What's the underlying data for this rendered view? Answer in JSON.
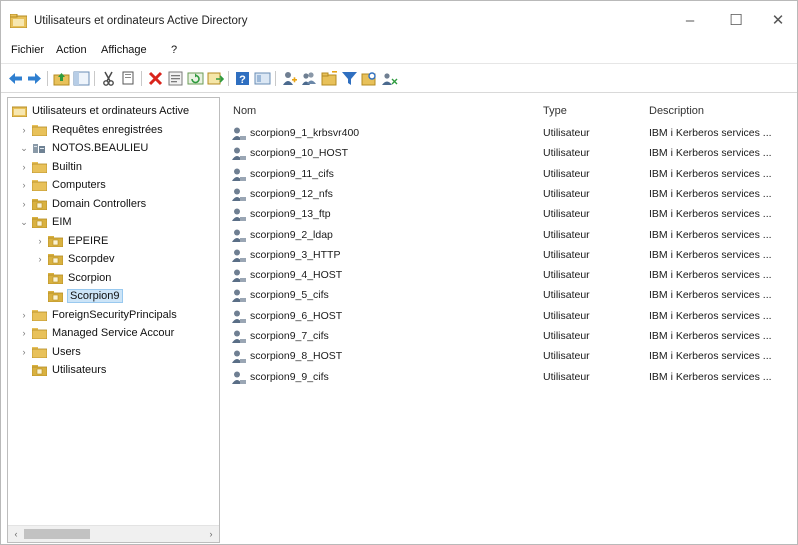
{
  "window": {
    "title": "Utilisateurs et ordinateurs Active Directory",
    "minimize_glyph": "–",
    "maximize_glyph": "☐",
    "close_glyph": "✕"
  },
  "menu": {
    "items": [
      "Fichier",
      "Action",
      "Affichage",
      "?"
    ]
  },
  "toolbar": {
    "icons": [
      "back-arrow-icon",
      "forward-arrow-icon",
      "folder-up-icon",
      "console-tree-icon",
      "cut-icon",
      "copy-icon",
      "delete-icon",
      "properties-icon",
      "refresh-icon",
      "export-list-icon",
      "help-icon",
      "mmc-icon",
      "add-user-icon",
      "add-group-icon",
      "add-ou-icon",
      "filter-icon",
      "find-icon",
      "add-to-group-icon"
    ]
  },
  "tree": {
    "items": [
      {
        "label": "Utilisateurs et ordinateurs Active",
        "level": 0,
        "expander": "",
        "icon": "root-icon"
      },
      {
        "label": "Requêtes enregistrées",
        "level": 1,
        "expander": "›",
        "icon": "folder-icon"
      },
      {
        "label": "NOTOS.BEAULIEU",
        "level": 1,
        "expander": "⌄",
        "icon": "domain-icon"
      },
      {
        "label": "Builtin",
        "level": 2,
        "expander": "›",
        "icon": "folder-icon"
      },
      {
        "label": "Computers",
        "level": 2,
        "expander": "›",
        "icon": "folder-icon"
      },
      {
        "label": "Domain Controllers",
        "level": 2,
        "expander": "›",
        "icon": "ou-folder-icon"
      },
      {
        "label": "EIM",
        "level": 2,
        "expander": "⌄",
        "icon": "ou-folder-icon"
      },
      {
        "label": "EPEIRE",
        "level": 3,
        "expander": "›",
        "icon": "ou-folder-icon"
      },
      {
        "label": "Scorpdev",
        "level": 3,
        "expander": "›",
        "icon": "ou-folder-icon"
      },
      {
        "label": "Scorpion",
        "level": 3,
        "expander": "",
        "icon": "ou-folder-icon"
      },
      {
        "label": "Scorpion9",
        "level": 3,
        "expander": "",
        "icon": "ou-folder-icon",
        "selected": true
      },
      {
        "label": "ForeignSecurityPrincipals",
        "level": 2,
        "expander": "›",
        "icon": "folder-icon"
      },
      {
        "label": "Managed Service Accour",
        "level": 2,
        "expander": "›",
        "icon": "folder-icon"
      },
      {
        "label": "Users",
        "level": 2,
        "expander": "›",
        "icon": "folder-icon"
      },
      {
        "label": "Utilisateurs",
        "level": 2,
        "expander": "",
        "icon": "ou-folder-icon"
      }
    ],
    "scroll_left_glyph": "‹",
    "scroll_right_glyph": "›"
  },
  "list": {
    "columns": {
      "name": "Nom",
      "type": "Type",
      "description": "Description"
    },
    "rows": [
      {
        "name": "scorpion9_1_krbsvr400",
        "type": "Utilisateur",
        "description": "IBM i Kerberos services ..."
      },
      {
        "name": "scorpion9_10_HOST",
        "type": "Utilisateur",
        "description": "IBM i Kerberos services ..."
      },
      {
        "name": "scorpion9_11_cifs",
        "type": "Utilisateur",
        "description": "IBM i Kerberos services ..."
      },
      {
        "name": "scorpion9_12_nfs",
        "type": "Utilisateur",
        "description": "IBM i Kerberos services ..."
      },
      {
        "name": "scorpion9_13_ftp",
        "type": "Utilisateur",
        "description": "IBM i Kerberos services ..."
      },
      {
        "name": "scorpion9_2_ldap",
        "type": "Utilisateur",
        "description": "IBM i Kerberos services ..."
      },
      {
        "name": "scorpion9_3_HTTP",
        "type": "Utilisateur",
        "description": "IBM i Kerberos services ..."
      },
      {
        "name": "scorpion9_4_HOST",
        "type": "Utilisateur",
        "description": "IBM i Kerberos services ..."
      },
      {
        "name": "scorpion9_5_cifs",
        "type": "Utilisateur",
        "description": "IBM i Kerberos services ..."
      },
      {
        "name": "scorpion9_6_HOST",
        "type": "Utilisateur",
        "description": "IBM i Kerberos services ..."
      },
      {
        "name": "scorpion9_7_cifs",
        "type": "Utilisateur",
        "description": "IBM i Kerberos services ..."
      },
      {
        "name": "scorpion9_8_HOST",
        "type": "Utilisateur",
        "description": "IBM i Kerberos services ..."
      },
      {
        "name": "scorpion9_9_cifs",
        "type": "Utilisateur",
        "description": "IBM i Kerberos services ..."
      }
    ]
  },
  "colors": {
    "folder": "#e8c15a",
    "ou_folder": "#d9b140",
    "selection": "#cce4f7",
    "user_icon": "#5a6e86"
  }
}
